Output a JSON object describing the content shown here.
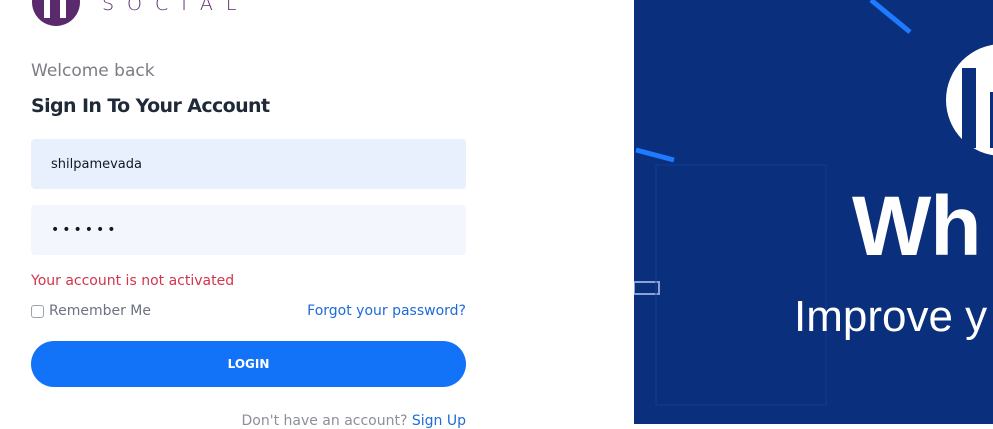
{
  "brand": {
    "logo_text": "SOCIAL"
  },
  "form": {
    "welcome": "Welcome back",
    "heading": "Sign In To Your Account",
    "username_value": "shilpamevada",
    "password_value": "••••••",
    "error": "Your account is not activated",
    "remember_label": "Remember Me",
    "forgot_label": "Forgot your password?",
    "login_label": "LOGIN",
    "signup_prompt": "Don't have an account?",
    "signup_link": "Sign Up"
  },
  "promo": {
    "title": "Wh",
    "subtitle": "Improve y"
  },
  "colors": {
    "accent": "#1373f8",
    "error": "#d3344a",
    "promo_bg": "#0a2f7c"
  }
}
